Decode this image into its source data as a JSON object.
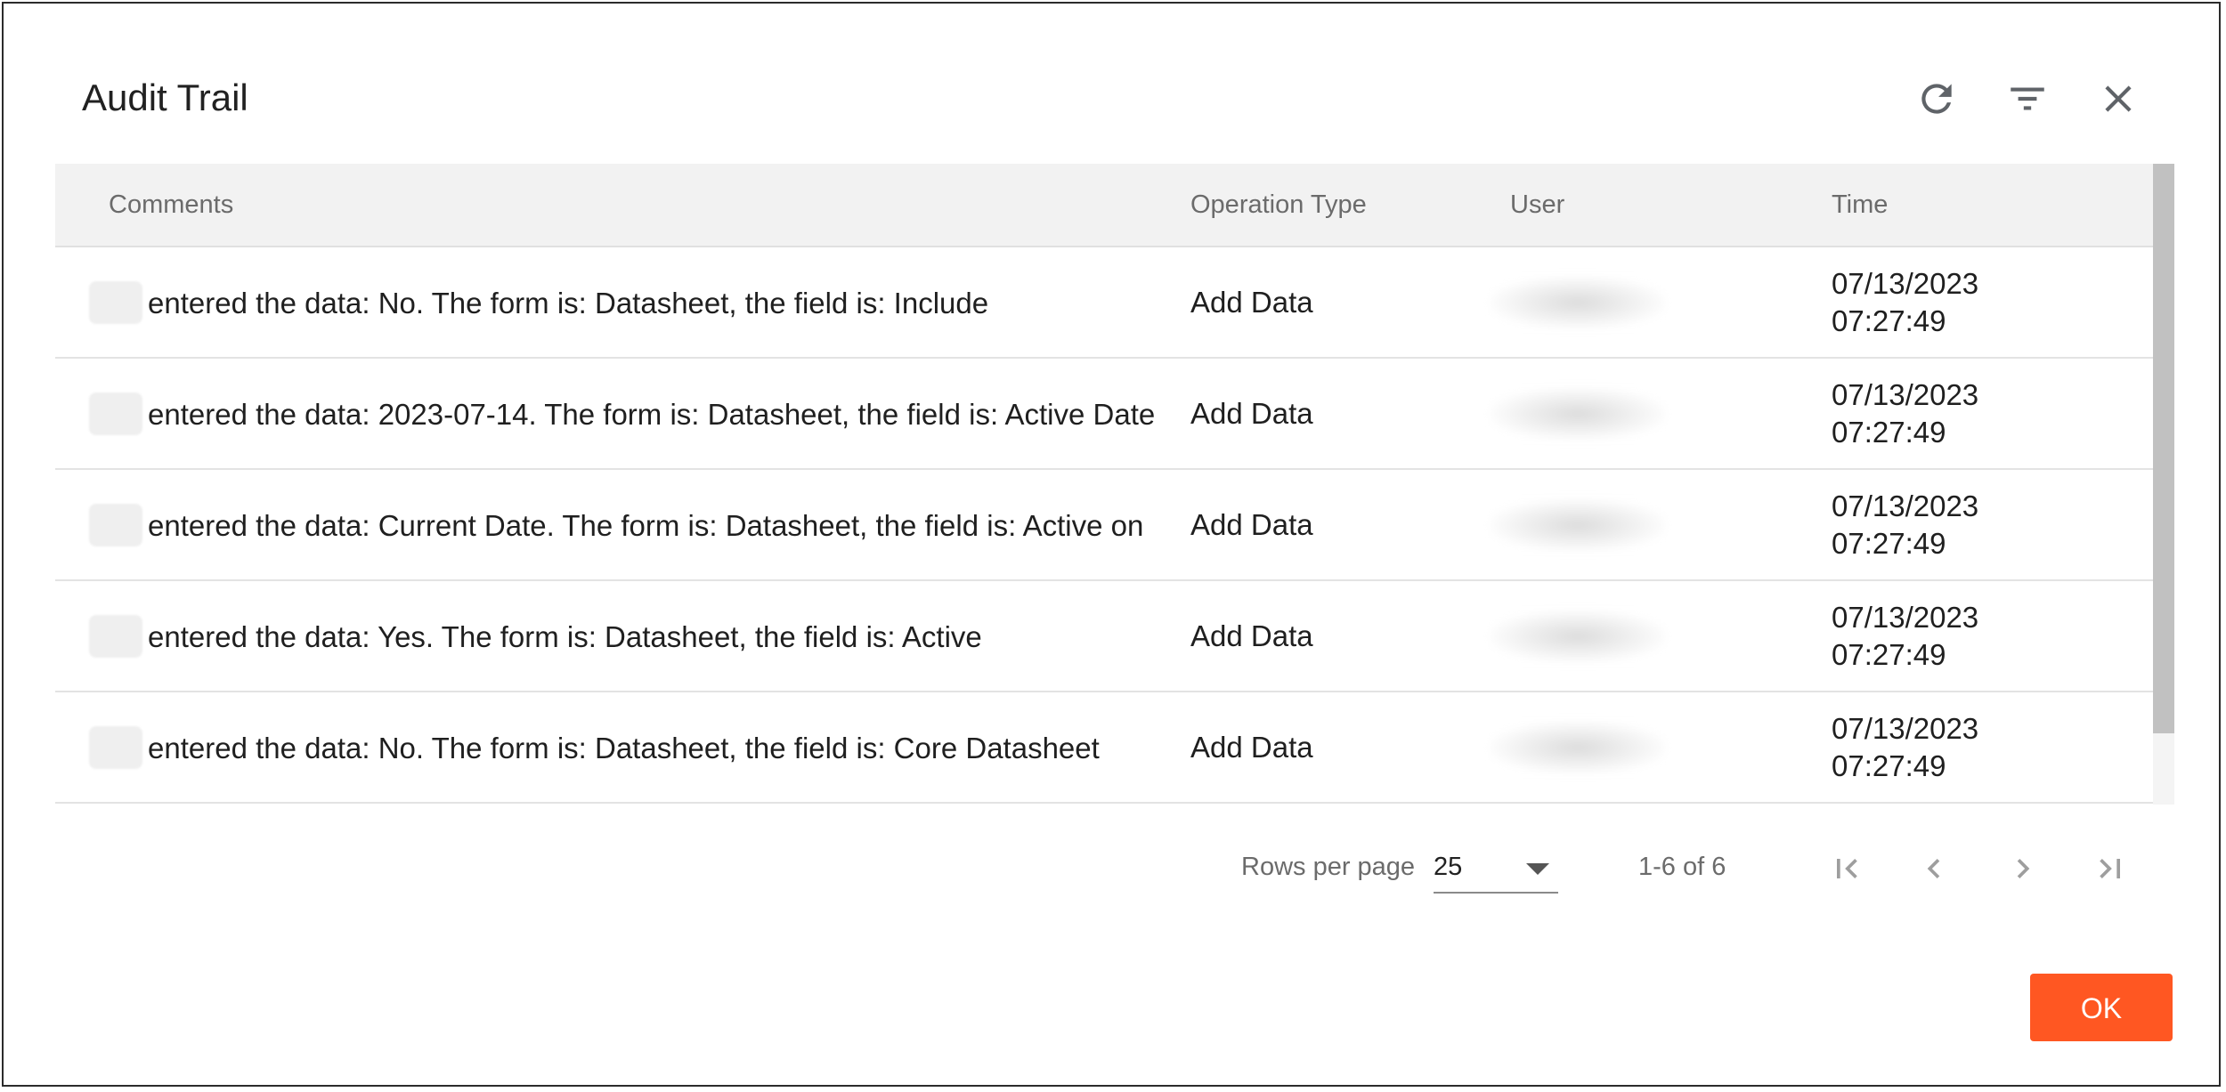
{
  "dialog": {
    "title": "Audit Trail",
    "icons": [
      "refresh-icon",
      "filter-icon",
      "close-icon"
    ]
  },
  "table": {
    "columns": [
      "Comments",
      "Operation Type",
      "User",
      "Time"
    ],
    "rows": [
      {
        "comment": "entered the data: No. The form is: Datasheet, the field is: Include",
        "operation": "Add Data",
        "time_date": "07/13/2023",
        "time_clock": "07:27:49"
      },
      {
        "comment": "entered the data: 2023-07-14. The form is: Datasheet, the field is: Active Date",
        "operation": "Add Data",
        "time_date": "07/13/2023",
        "time_clock": "07:27:49"
      },
      {
        "comment": "entered the data: Current Date. The form is: Datasheet, the field is: Active on",
        "operation": "Add Data",
        "time_date": "07/13/2023",
        "time_clock": "07:27:49"
      },
      {
        "comment": "entered the data: Yes. The form is: Datasheet, the field is: Active",
        "operation": "Add Data",
        "time_date": "07/13/2023",
        "time_clock": "07:27:49"
      },
      {
        "comment": "entered the data: No. The form is: Datasheet, the field is: Core Datasheet",
        "operation": "Add Data",
        "time_date": "07/13/2023",
        "time_clock": "07:27:49"
      }
    ]
  },
  "pagination": {
    "rows_per_page_label": "Rows per page",
    "rows_per_page_value": "25",
    "range_text": "1-6 of 6",
    "icons": [
      "first-page-icon",
      "previous-page-icon",
      "next-page-icon",
      "last-page-icon"
    ]
  },
  "footer": {
    "ok_label": "OK",
    "ok_color": "#ff5722"
  }
}
